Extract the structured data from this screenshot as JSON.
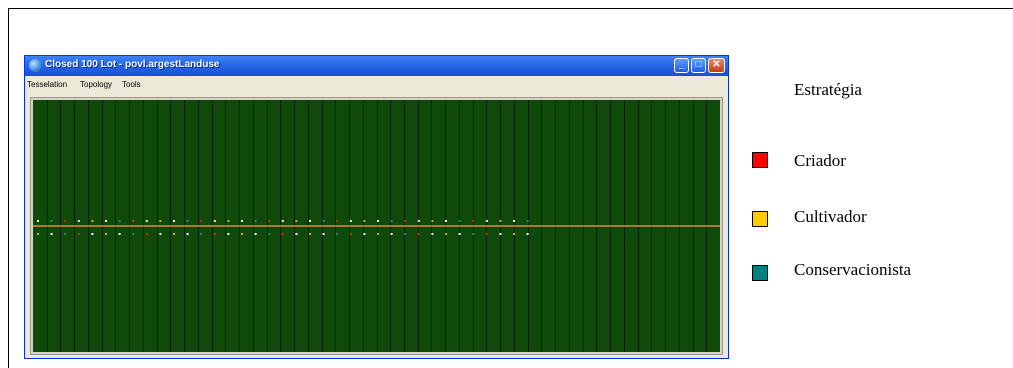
{
  "window": {
    "title": "Closed 100  Lot  - povl.argestLanduse",
    "minimize_glyph": "_",
    "maximize_glyph": "□",
    "close_glyph": "✕",
    "icon": "globe-icon"
  },
  "menu": {
    "items": [
      {
        "label": "Tesselation"
      },
      {
        "label": "Topology"
      },
      {
        "label": "Tools"
      }
    ]
  },
  "canvas": {
    "background_color": "#0f4a0a",
    "stripe_line_color": "#051f03",
    "column_count": 50,
    "horizon_line_color": "#b07a2a",
    "agent_rows": 2,
    "agents_per_row": 37,
    "agent_colors": [
      "#ffffff",
      "#cc3300",
      "#d9b000",
      "#1a8a8a",
      "#f2f2f2"
    ]
  },
  "legend": {
    "title": "Estratégia",
    "items": [
      {
        "label": "Criador",
        "color": "#ff0000"
      },
      {
        "label": "Cultivador",
        "color": "#ffcc00"
      },
      {
        "label": "Conservacionista",
        "color": "#008080"
      }
    ]
  }
}
